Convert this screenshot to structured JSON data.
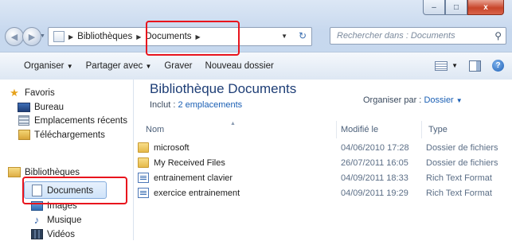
{
  "window": {
    "controls": {
      "minimize": "–",
      "maximize": "□",
      "close": "x"
    }
  },
  "navigation": {
    "address": {
      "crumbs": [
        "Bibliothèques",
        "Documents"
      ]
    },
    "search": {
      "placeholder": "Rechercher dans : Documents"
    }
  },
  "toolbar": {
    "organiser": "Organiser",
    "partager": "Partager avec",
    "graver": "Graver",
    "nouveau_dossier": "Nouveau dossier"
  },
  "sidebar": {
    "favoris": "Favoris",
    "bureau": "Bureau",
    "emplacements": "Emplacements récents",
    "telechargements": "Téléchargements",
    "bibliotheques": "Bibliothèques",
    "documents": "Documents",
    "images": "Images",
    "musique": "Musique",
    "videos": "Vidéos"
  },
  "main": {
    "title": "Bibliothèque Documents",
    "include_label": "Inclut :",
    "include_link": "2 emplacements",
    "arrange_label": "Organiser par :",
    "arrange_value": "Dossier",
    "columns": {
      "name": "Nom",
      "modified": "Modifié le",
      "type": "Type"
    },
    "files": [
      {
        "name": "microsoft",
        "date": "04/06/2010 17:28",
        "type": "Dossier de fichiers",
        "kind": "folder"
      },
      {
        "name": "My Received Files",
        "date": "26/07/2011 16:05",
        "type": "Dossier de fichiers",
        "kind": "folder"
      },
      {
        "name": "entrainement clavier",
        "date": "04/09/2011 18:33",
        "type": "Rich Text Format",
        "kind": "rtf"
      },
      {
        "name": "exercice entrainement",
        "date": "04/09/2011 19:29",
        "type": "Rich Text Format",
        "kind": "rtf"
      }
    ]
  },
  "colors": {
    "highlight": "#e8141d",
    "link": "#1a5fb4",
    "title": "#1e3e76"
  }
}
